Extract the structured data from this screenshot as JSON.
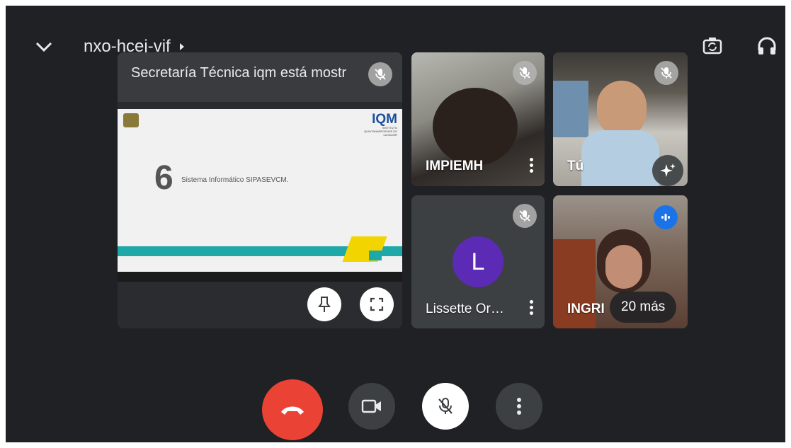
{
  "header": {
    "meeting_code": "nxo-hcej-vif",
    "icons": [
      "chevron-down-icon",
      "meeting-info-arrow-icon",
      "switch-camera-icon",
      "audio-output-icon"
    ]
  },
  "presentation": {
    "caption": "Secretaría Técnica iqm está mostr",
    "slide": {
      "logo_text": "IQM",
      "logo_subtext": "INSTITUTO QUINTANARROENSE DE LA MUJER",
      "number": "6",
      "title": "Sistema Informático SIPASEVCM."
    }
  },
  "participants": [
    {
      "name": "IMPIEMH"
    },
    {
      "name": "Tú"
    },
    {
      "name": "Lissette Or…",
      "initial": "L"
    },
    {
      "name": "INGRI",
      "more": "20 más"
    }
  ],
  "colors": {
    "background": "#202124",
    "tile": "#3c4043",
    "end_call": "#ea4335",
    "avatar": "#5b2bb5",
    "speaking": "#1a73e8"
  }
}
